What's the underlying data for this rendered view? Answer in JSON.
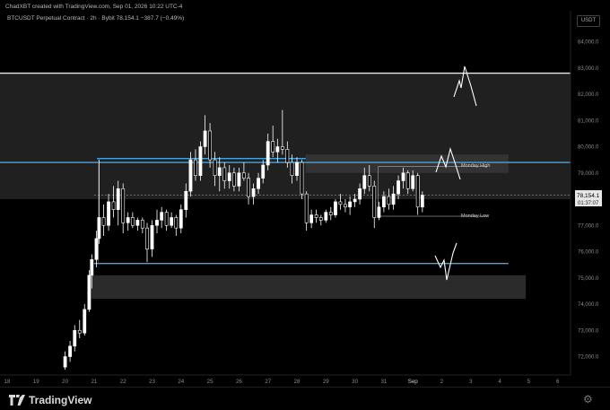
{
  "header": {
    "created_by": "ChadXBT created with TradingView.com, Sep 01, 2026 10:22 UTC-4",
    "symbol": "BTCUSDT Perpetual Contract · 2h · Bybit",
    "last": "78,154.1",
    "change": "−387.7 (−0.49%)",
    "currency": "USDT"
  },
  "price_badge": {
    "price": "78,154.1",
    "countdown": "01:37:07"
  },
  "annotations": {
    "monday_high": "Monday High",
    "monday_low": "Monday Low"
  },
  "footer": {
    "brand": "TradingView"
  },
  "colors": {
    "background": "#000000",
    "zone": "#3a3a3a",
    "blue_line": "#4aa3df",
    "white_line": "#e8e8e8",
    "candle": "#ffffff"
  },
  "chart_data": {
    "type": "candlestick",
    "y_axis": {
      "ylim": [
        71500,
        85000
      ],
      "ticks": [
        {
          "value": 72000,
          "label": "72,000.0"
        },
        {
          "value": 73000,
          "label": "73,000.0"
        },
        {
          "value": 74000,
          "label": "74,000.0"
        },
        {
          "value": 75000,
          "label": "75,000.0"
        },
        {
          "value": 76000,
          "label": "76,000.0"
        },
        {
          "value": 77000,
          "label": "77,000.0"
        },
        {
          "value": 78000,
          "label": "78,000.0"
        },
        {
          "value": 79000,
          "label": "79,000.0"
        },
        {
          "value": 80000,
          "label": "80,000.0"
        },
        {
          "value": 81000,
          "label": "81,000.0"
        },
        {
          "value": 82000,
          "label": "82,000.0"
        },
        {
          "value": 83000,
          "label": "83,000.0"
        },
        {
          "value": 84000,
          "label": "84,000.0"
        }
      ]
    },
    "x_axis": {
      "ticks": [
        {
          "day": 18,
          "label": "18"
        },
        {
          "day": 19,
          "label": "19"
        },
        {
          "day": 20,
          "label": "20"
        },
        {
          "day": 21,
          "label": "21"
        },
        {
          "day": 22,
          "label": "22"
        },
        {
          "day": 23,
          "label": "23"
        },
        {
          "day": 24,
          "label": "24"
        },
        {
          "day": 25,
          "label": "25"
        },
        {
          "day": 26,
          "label": "26"
        },
        {
          "day": 27,
          "label": "27"
        },
        {
          "day": 28,
          "label": "28"
        },
        {
          "day": 29,
          "label": "29"
        },
        {
          "day": 30,
          "label": "30"
        },
        {
          "day": 31,
          "label": "31"
        },
        {
          "day": 32,
          "label": "Sep"
        },
        {
          "day": 33,
          "label": "2"
        },
        {
          "day": 34,
          "label": "3"
        },
        {
          "day": 35,
          "label": "4"
        },
        {
          "day": 36,
          "label": "5"
        },
        {
          "day": 37,
          "label": "6"
        }
      ]
    },
    "zones": [
      {
        "name": "upper-range-zone",
        "from_day": 16.5,
        "to_day": 39.5,
        "low": 78000,
        "high": 82800
      },
      {
        "name": "supply-zone",
        "from_day": 28.3,
        "to_day": 35.3,
        "low": 79000,
        "high": 79700
      },
      {
        "name": "demand-zone",
        "from_day": 20.9,
        "to_day": 35.9,
        "low": 74200,
        "high": 75100
      }
    ],
    "levels": [
      {
        "name": "range-high-line",
        "price": 82800,
        "from_day": 16.5,
        "to_day": 38.4,
        "color": "#e8e8e8"
      },
      {
        "name": "resistance-blue-line",
        "price": 79400,
        "from_day": 16.5,
        "to_day": 39.5,
        "color": "#4aa3df"
      },
      {
        "name": "resistance-blue-line-2",
        "price": 79550,
        "from_day": 21.1,
        "to_day": 28.3,
        "color": "#4aa3df"
      },
      {
        "name": "support-blue-line",
        "price": 75550,
        "from_day": 21.0,
        "to_day": 35.3,
        "color": "#4aa3df"
      },
      {
        "name": "monday-high-line",
        "price": 79250,
        "from_day": 30.8,
        "to_day": 34.6,
        "color": "#888888"
      },
      {
        "name": "monday-low-line",
        "price": 77350,
        "from_day": 30.8,
        "to_day": 34.6,
        "color": "#888888"
      }
    ],
    "current_price": 78154.1,
    "candles": [
      {
        "day": 20.0,
        "o": 71600,
        "h": 72200,
        "l": 71500,
        "c": 72000
      },
      {
        "day": 20.17,
        "o": 72000,
        "h": 72600,
        "l": 71800,
        "c": 72400
      },
      {
        "day": 20.33,
        "o": 72400,
        "h": 73200,
        "l": 72200,
        "c": 73000
      },
      {
        "day": 20.5,
        "o": 73000,
        "h": 73400,
        "l": 72700,
        "c": 72900
      },
      {
        "day": 20.67,
        "o": 72900,
        "h": 74000,
        "l": 72800,
        "c": 73800
      },
      {
        "day": 20.83,
        "o": 73800,
        "h": 75300,
        "l": 73700,
        "c": 75100
      },
      {
        "day": 20.92,
        "o": 75100,
        "h": 75900,
        "l": 74600,
        "c": 75700
      },
      {
        "day": 21.08,
        "o": 75700,
        "h": 76800,
        "l": 75400,
        "c": 76500
      },
      {
        "day": 21.17,
        "o": 76500,
        "h": 79500,
        "l": 76300,
        "c": 77300
      },
      {
        "day": 21.33,
        "o": 77300,
        "h": 77800,
        "l": 76600,
        "c": 77000
      },
      {
        "day": 21.5,
        "o": 77000,
        "h": 78200,
        "l": 76800,
        "c": 77900
      },
      {
        "day": 21.67,
        "o": 77900,
        "h": 78500,
        "l": 77300,
        "c": 77600
      },
      {
        "day": 21.83,
        "o": 77600,
        "h": 78700,
        "l": 77000,
        "c": 78400
      },
      {
        "day": 22.0,
        "o": 78400,
        "h": 78600,
        "l": 76700,
        "c": 77100
      },
      {
        "day": 22.17,
        "o": 77100,
        "h": 77500,
        "l": 76800,
        "c": 77300
      },
      {
        "day": 22.33,
        "o": 77300,
        "h": 77500,
        "l": 76900,
        "c": 77000
      },
      {
        "day": 22.5,
        "o": 77000,
        "h": 77300,
        "l": 76800,
        "c": 77200
      },
      {
        "day": 22.67,
        "o": 77200,
        "h": 77300,
        "l": 76700,
        "c": 76900
      },
      {
        "day": 22.83,
        "o": 76900,
        "h": 77100,
        "l": 75600,
        "c": 76100
      },
      {
        "day": 23.0,
        "o": 76100,
        "h": 77200,
        "l": 75800,
        "c": 77000
      },
      {
        "day": 23.17,
        "o": 77000,
        "h": 77600,
        "l": 76700,
        "c": 77200
      },
      {
        "day": 23.33,
        "o": 77200,
        "h": 77700,
        "l": 76900,
        "c": 77500
      },
      {
        "day": 23.5,
        "o": 77500,
        "h": 77600,
        "l": 76800,
        "c": 77000
      },
      {
        "day": 23.67,
        "o": 77000,
        "h": 77500,
        "l": 76900,
        "c": 77300
      },
      {
        "day": 23.83,
        "o": 77300,
        "h": 77400,
        "l": 76600,
        "c": 76900
      },
      {
        "day": 24.0,
        "o": 76900,
        "h": 77800,
        "l": 76700,
        "c": 77600
      },
      {
        "day": 24.17,
        "o": 77600,
        "h": 78600,
        "l": 77300,
        "c": 78300
      },
      {
        "day": 24.33,
        "o": 78300,
        "h": 79800,
        "l": 78100,
        "c": 79500
      },
      {
        "day": 24.5,
        "o": 79500,
        "h": 79900,
        "l": 78700,
        "c": 78900
      },
      {
        "day": 24.67,
        "o": 78900,
        "h": 80200,
        "l": 78700,
        "c": 80000
      },
      {
        "day": 24.83,
        "o": 80000,
        "h": 81200,
        "l": 79700,
        "c": 80600
      },
      {
        "day": 25.0,
        "o": 80600,
        "h": 80900,
        "l": 79200,
        "c": 79500
      },
      {
        "day": 25.17,
        "o": 79500,
        "h": 79800,
        "l": 78500,
        "c": 78900
      },
      {
        "day": 25.33,
        "o": 78900,
        "h": 79600,
        "l": 78300,
        "c": 79200
      },
      {
        "day": 25.5,
        "o": 79200,
        "h": 79400,
        "l": 78400,
        "c": 78700
      },
      {
        "day": 25.67,
        "o": 78700,
        "h": 79300,
        "l": 78400,
        "c": 79000
      },
      {
        "day": 25.83,
        "o": 79000,
        "h": 79200,
        "l": 78300,
        "c": 78500
      },
      {
        "day": 26.0,
        "o": 78500,
        "h": 79200,
        "l": 78300,
        "c": 79000
      },
      {
        "day": 26.17,
        "o": 79000,
        "h": 79400,
        "l": 78700,
        "c": 78800
      },
      {
        "day": 26.33,
        "o": 78800,
        "h": 79000,
        "l": 77800,
        "c": 78100
      },
      {
        "day": 26.5,
        "o": 78100,
        "h": 78600,
        "l": 77800,
        "c": 78400
      },
      {
        "day": 26.67,
        "o": 78400,
        "h": 79000,
        "l": 78200,
        "c": 78800
      },
      {
        "day": 26.83,
        "o": 78800,
        "h": 79500,
        "l": 78600,
        "c": 79300
      },
      {
        "day": 27.0,
        "o": 79300,
        "h": 80500,
        "l": 79100,
        "c": 80200
      },
      {
        "day": 27.17,
        "o": 80200,
        "h": 80800,
        "l": 79600,
        "c": 79800
      },
      {
        "day": 27.33,
        "o": 79800,
        "h": 80300,
        "l": 79400,
        "c": 80000
      },
      {
        "day": 27.5,
        "o": 80000,
        "h": 81400,
        "l": 79700,
        "c": 79900
      },
      {
        "day": 27.67,
        "o": 79900,
        "h": 80200,
        "l": 79200,
        "c": 79400
      },
      {
        "day": 27.83,
        "o": 79400,
        "h": 79700,
        "l": 78600,
        "c": 78900
      },
      {
        "day": 28.0,
        "o": 78900,
        "h": 79600,
        "l": 78700,
        "c": 79400
      },
      {
        "day": 28.17,
        "o": 79400,
        "h": 79500,
        "l": 78000,
        "c": 78200
      },
      {
        "day": 28.33,
        "o": 78200,
        "h": 78300,
        "l": 76800,
        "c": 77100
      },
      {
        "day": 28.5,
        "o": 77100,
        "h": 77600,
        "l": 76900,
        "c": 77400
      },
      {
        "day": 28.67,
        "o": 77400,
        "h": 77600,
        "l": 77100,
        "c": 77300
      },
      {
        "day": 28.83,
        "o": 77300,
        "h": 77400,
        "l": 77000,
        "c": 77200
      },
      {
        "day": 29.0,
        "o": 77200,
        "h": 77600,
        "l": 77100,
        "c": 77500
      },
      {
        "day": 29.17,
        "o": 77500,
        "h": 77700,
        "l": 77200,
        "c": 77400
      },
      {
        "day": 29.33,
        "o": 77400,
        "h": 78000,
        "l": 77300,
        "c": 77900
      },
      {
        "day": 29.5,
        "o": 77900,
        "h": 78200,
        "l": 77600,
        "c": 77800
      },
      {
        "day": 29.67,
        "o": 77800,
        "h": 78000,
        "l": 77500,
        "c": 77700
      },
      {
        "day": 29.83,
        "o": 77700,
        "h": 78100,
        "l": 77400,
        "c": 77900
      },
      {
        "day": 30.0,
        "o": 77900,
        "h": 78200,
        "l": 77700,
        "c": 78000
      },
      {
        "day": 30.17,
        "o": 78000,
        "h": 78600,
        "l": 77800,
        "c": 78400
      },
      {
        "day": 30.33,
        "o": 78400,
        "h": 79200,
        "l": 78200,
        "c": 78900
      },
      {
        "day": 30.5,
        "o": 78900,
        "h": 79300,
        "l": 78300,
        "c": 78500
      },
      {
        "day": 30.67,
        "o": 78500,
        "h": 78700,
        "l": 76900,
        "c": 77300
      },
      {
        "day": 30.83,
        "o": 77300,
        "h": 77900,
        "l": 77200,
        "c": 77700
      },
      {
        "day": 31.0,
        "o": 77700,
        "h": 78300,
        "l": 77500,
        "c": 78100
      },
      {
        "day": 31.17,
        "o": 78100,
        "h": 78400,
        "l": 77600,
        "c": 77800
      },
      {
        "day": 31.33,
        "o": 77800,
        "h": 78500,
        "l": 77600,
        "c": 78200
      },
      {
        "day": 31.5,
        "o": 78200,
        "h": 78900,
        "l": 78000,
        "c": 78700
      },
      {
        "day": 31.67,
        "o": 78700,
        "h": 79200,
        "l": 78400,
        "c": 79000
      },
      {
        "day": 31.83,
        "o": 79000,
        "h": 79100,
        "l": 78200,
        "c": 78400
      },
      {
        "day": 32.0,
        "o": 78400,
        "h": 79100,
        "l": 78300,
        "c": 78900
      },
      {
        "day": 32.17,
        "o": 78900,
        "h": 79000,
        "l": 77400,
        "c": 77700
      },
      {
        "day": 32.33,
        "o": 77700,
        "h": 78300,
        "l": 77500,
        "c": 78154.1
      }
    ]
  }
}
